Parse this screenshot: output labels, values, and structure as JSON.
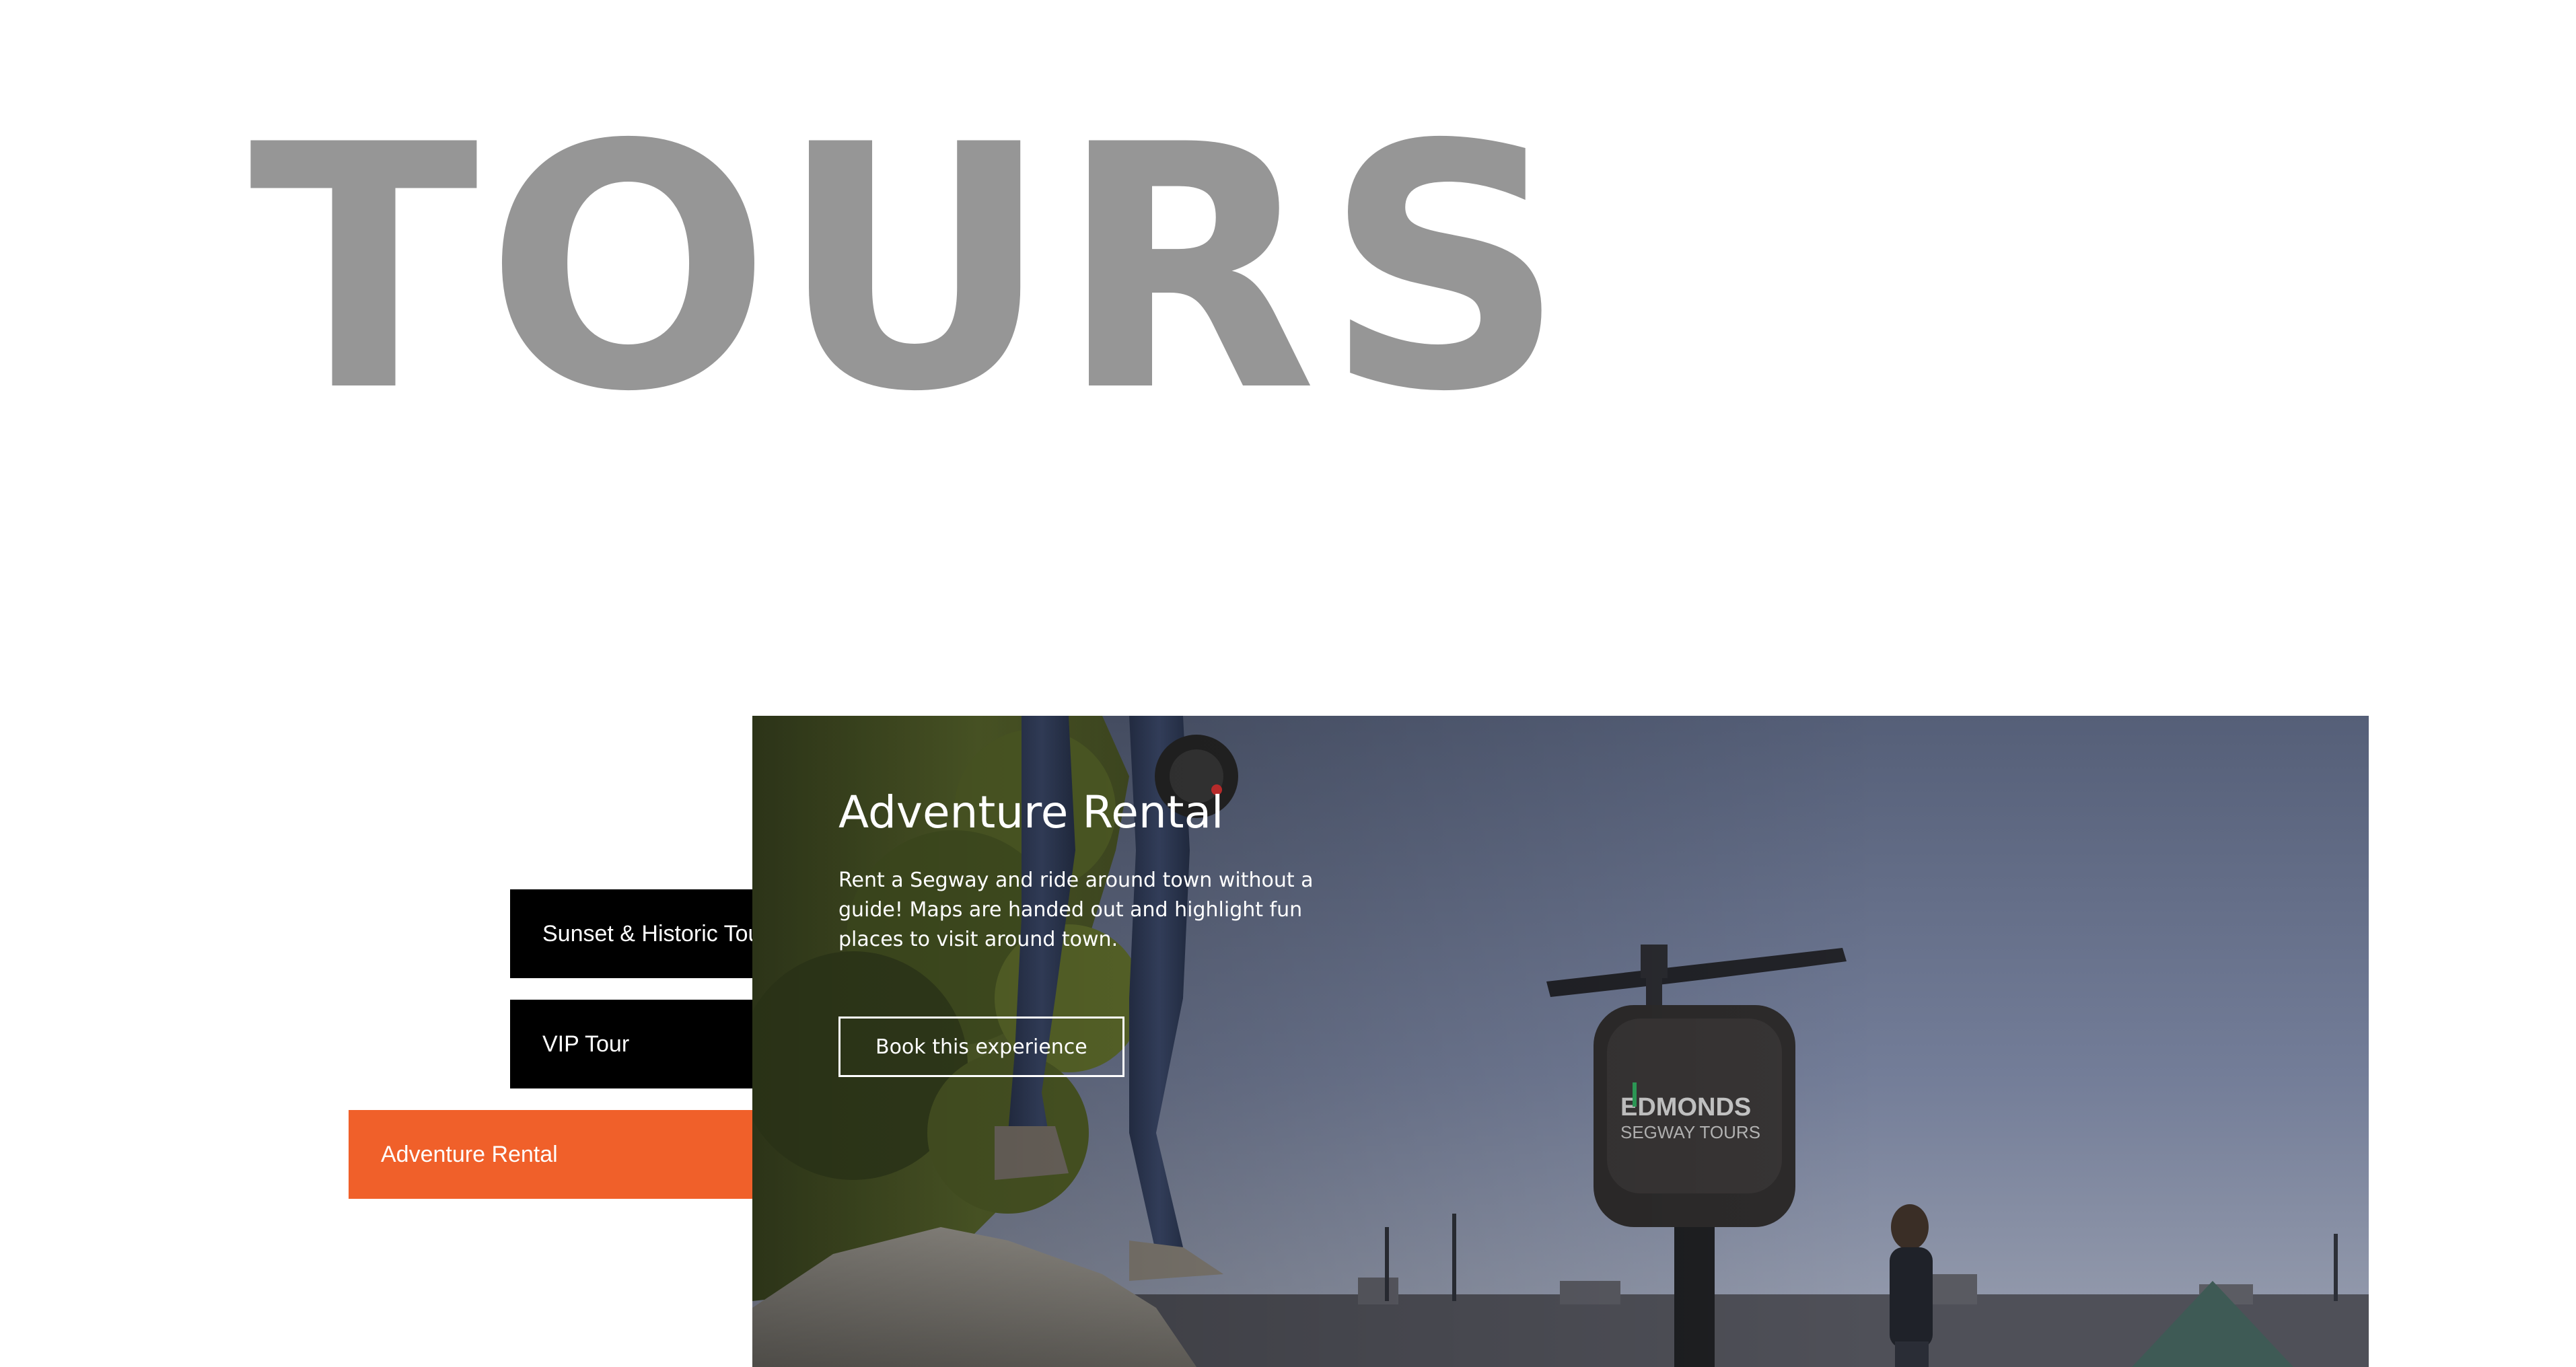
{
  "header": {
    "title": "TOURS"
  },
  "tabs": [
    {
      "label": "Sunset & Historic Tour",
      "active": false
    },
    {
      "label": "VIP Tour",
      "active": false
    },
    {
      "label": "Adventure Rental",
      "active": true
    }
  ],
  "hero": {
    "title": "Adventure Rental",
    "description": "Rent a Segway and ride around town without a guide! Maps are handed out and highlight fun places to visit around town.",
    "button_label": "Book this experience",
    "logo": {
      "line1": "EDMONDS",
      "line2": "SEGWAY TOURS"
    }
  },
  "colors": {
    "accent": "#f0602a",
    "title_gray": "#969696",
    "tab_dark": "#000000"
  }
}
